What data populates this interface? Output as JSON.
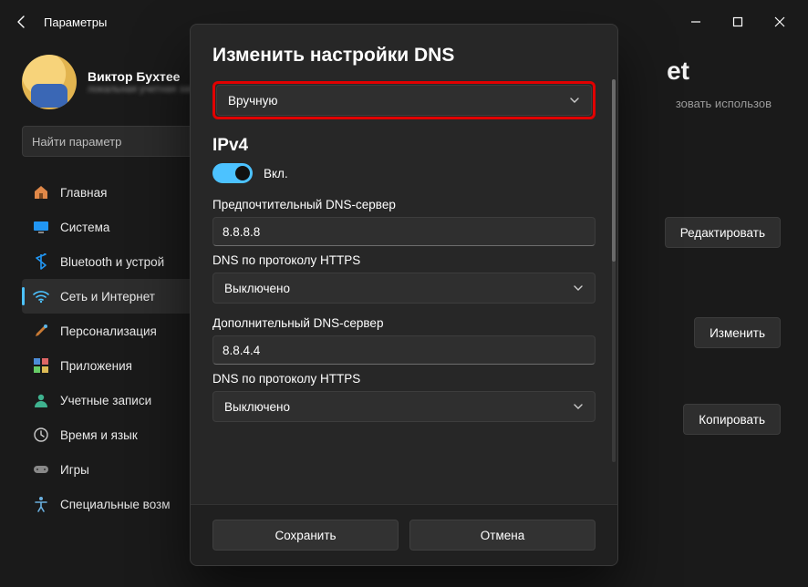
{
  "window": {
    "title": "Параметры"
  },
  "profile": {
    "name": "Виктор Бухтее",
    "sub": "локальная учетная запись"
  },
  "search": {
    "placeholder": "Найти параметр"
  },
  "nav": {
    "items": [
      {
        "label": "Главная",
        "icon": "home"
      },
      {
        "label": "Система",
        "icon": "system"
      },
      {
        "label": "Bluetooth и устрой",
        "icon": "bluetooth"
      },
      {
        "label": "Сеть и Интернет",
        "icon": "wifi",
        "active": true
      },
      {
        "label": "Персонализация",
        "icon": "brush"
      },
      {
        "label": "Приложения",
        "icon": "apps"
      },
      {
        "label": "Учетные записи",
        "icon": "account"
      },
      {
        "label": "Время и язык",
        "icon": "time"
      },
      {
        "label": "Игры",
        "icon": "games"
      },
      {
        "label": "Специальные возм",
        "icon": "accessibility"
      }
    ]
  },
  "background": {
    "title_fragment": "et",
    "subtitle_fragment": "зовать использов",
    "edit_button": "Редактировать",
    "change_button": "Изменить",
    "copy_button": "Копировать"
  },
  "dialog": {
    "title": "Изменить настройки DNS",
    "mode_selected": "Вручную",
    "ipv4_heading": "IPv4",
    "ipv4_toggle_label": "Вкл.",
    "preferred_label": "Предпочтительный DNS-сервер",
    "preferred_value": "8.8.8.8",
    "https1_label": "DNS по протоколу HTTPS",
    "https1_value": "Выключено",
    "alternate_label": "Дополнительный DNS-сервер",
    "alternate_value": "8.8.4.4",
    "https2_label": "DNS по протоколу HTTPS",
    "https2_value": "Выключено",
    "save_label": "Сохранить",
    "cancel_label": "Отмена"
  }
}
